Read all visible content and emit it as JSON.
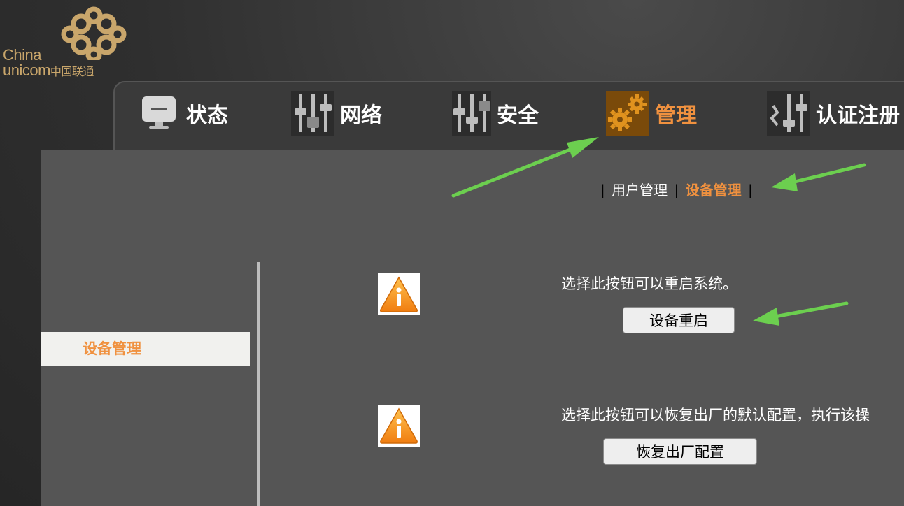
{
  "logo": {
    "line1": "China",
    "line2": "unicom",
    "line2_cn": "中国联通"
  },
  "nav": [
    {
      "label": "状态",
      "icon": "monitor-icon",
      "active": false
    },
    {
      "label": "网络",
      "icon": "sliders-icon",
      "active": false
    },
    {
      "label": "安全",
      "icon": "sliders-icon",
      "active": false
    },
    {
      "label": "管理",
      "icon": "gears-icon",
      "active": true
    },
    {
      "label": "认证注册",
      "icon": "sliders-icon",
      "active": false
    }
  ],
  "subnav": {
    "sep": "|",
    "user_mgmt": "用户管理",
    "device_mgmt": "设备管理"
  },
  "sidebar": {
    "active_item": "设备管理"
  },
  "actions": {
    "reboot_desc": "选择此按钮可以重启系统。",
    "reboot_button": "设备重启",
    "reset_desc": "选择此按钮可以恢复出厂的默认配置，执行该操",
    "reset_button": "恢复出厂配置"
  },
  "colors": {
    "accent": "#f0913f",
    "panel": "#555555",
    "arrow": "#6ccf4f"
  }
}
